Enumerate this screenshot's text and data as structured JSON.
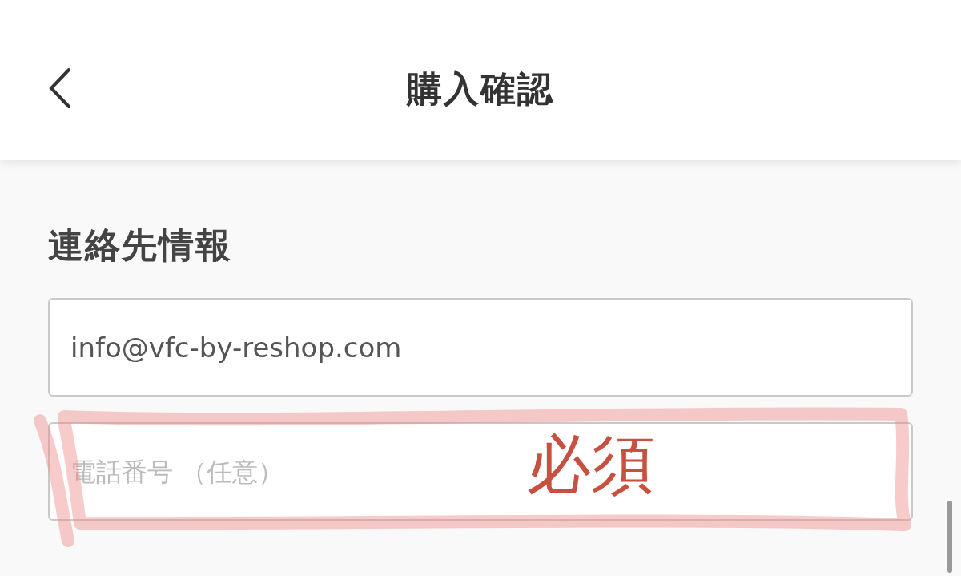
{
  "header": {
    "title": "購入確認"
  },
  "contact": {
    "heading": "連絡先情報",
    "email": {
      "value": "info@vfc-by-reshop.com"
    },
    "phone": {
      "placeholder": "電話番号 （任意）"
    }
  },
  "annotation": {
    "text": "必須"
  }
}
